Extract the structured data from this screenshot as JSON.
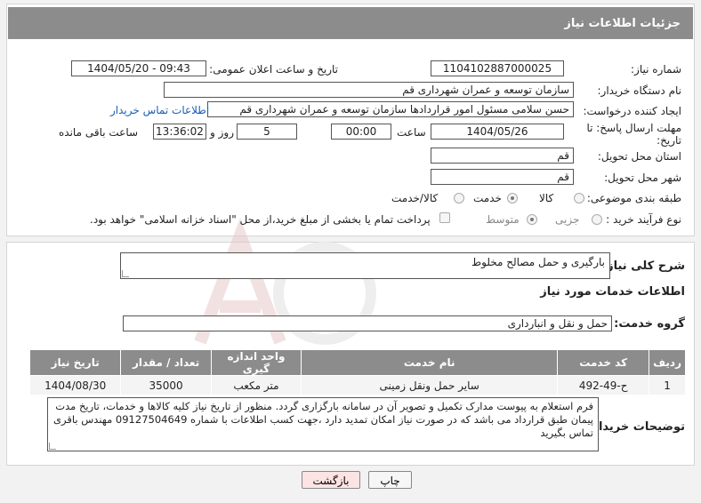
{
  "header": {
    "title": "جزئیات اطلاعات نیاز"
  },
  "form": {
    "need_number_label": "شماره نیاز:",
    "need_number": "1104102887000025",
    "announce_label": "تاریخ و ساعت اعلان عمومی:",
    "announce_value": "1404/05/20 - 09:43",
    "buyer_org_label": "نام دستگاه خریدار:",
    "buyer_org": "سازمان توسعه و عمران شهرداری قم",
    "requester_label": "ایجاد کننده درخواست:",
    "requester": "حسن سلامی مسئول امور قراردادها سازمان توسعه و عمران شهرداری قم",
    "buyer_contact_link": "اطلاعات تماس خریدار",
    "deadline_label_1": "مهلت ارسال پاسخ: تا",
    "deadline_label_2": "تاریخ:",
    "deadline_date": "1404/05/26",
    "time_label": "ساعت",
    "deadline_time": "00:00",
    "days_value": "5",
    "days_label": "روز و",
    "remaining_time": "13:36:02",
    "remaining_label": "ساعت باقی مانده",
    "province_label": "استان محل تحویل:",
    "province": "قم",
    "city_label": "شهر محل تحویل:",
    "city": "قم",
    "category_label": "طبقه بندی موضوعی:",
    "category_options": [
      "کالا",
      "خدمت",
      "کالا/خدمت"
    ],
    "category_selected": "خدمت",
    "process_label": "نوع فرآیند خرید :",
    "process_options": [
      "جزیی",
      "متوسط"
    ],
    "process_selected": "متوسط",
    "payment_note": "پرداخت تمام یا بخشی از مبلغ خرید،از محل \"اسناد خزانه اسلامی\" خواهد بود."
  },
  "details": {
    "summary_label": "شرح کلی نیاز:",
    "summary": "بارگیری و حمل مصالح مخلوط",
    "services_heading": "اطلاعات خدمات مورد نیاز",
    "service_group_label": "گروه خدمت:",
    "service_group": "حمل و نقل و انبارداری"
  },
  "table": {
    "headers": [
      "ردیف",
      "کد خدمت",
      "نام خدمت",
      "واحد اندازه گیری",
      "تعداد / مقدار",
      "تاریخ نیاز"
    ],
    "rows": [
      [
        "1",
        "ح-49-492",
        "سایر حمل ونقل زمینی",
        "متر مکعب",
        "35000",
        "1404/08/30"
      ]
    ]
  },
  "buyer_notes": {
    "label": "توضیحات خریدار:",
    "text": "فرم استعلام به پیوست مدارک تکمیل و تصویر آن در سامانه بارگزاری گردد. منظور از تاریخ نیاز کلیه کالاها و خدمات، تاریخ مدت پیمان طبق قرارداد می باشد که در صورت نیاز امکان تمدید دارد ،جهت کسب اطلاعات با شماره 09127504649 مهندس باقری تماس بگیرید"
  },
  "buttons": {
    "print": "چاپ",
    "back": "بازگشت"
  },
  "colors": {
    "header_bg": "#8c8c8c",
    "link": "#1a5fb4",
    "back_btn_bg": "#fde4e4",
    "print_btn_bg": "#f6f6f6"
  }
}
